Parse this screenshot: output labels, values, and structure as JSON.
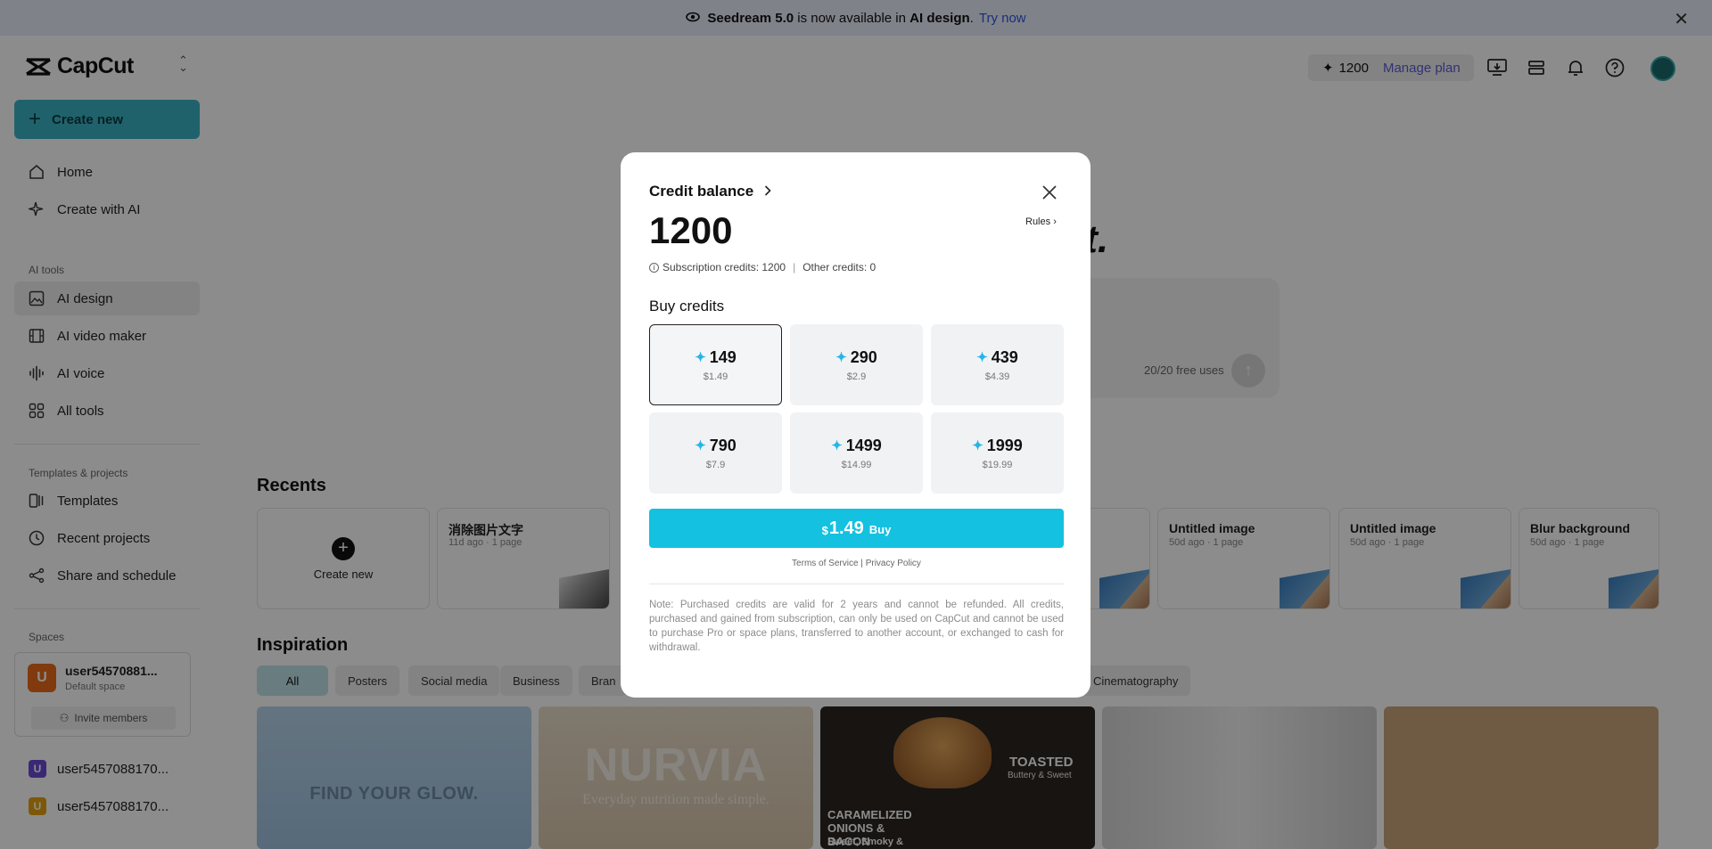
{
  "banner": {
    "icon": "seedream-icon",
    "product": "Seedream 5.0",
    "text_mid": " is now available in ",
    "feature": "AI design",
    "text_end": ".",
    "link": "Try now"
  },
  "sidebar": {
    "logo": "CapCut",
    "create_new": "Create new",
    "nav_main": [
      {
        "label": "Home",
        "icon": "home-icon"
      },
      {
        "label": "Create with AI",
        "icon": "sparkle-icon"
      }
    ],
    "ai_tools_label": "AI tools",
    "ai_tools": [
      {
        "label": "AI design",
        "icon": "image-edit-icon",
        "active": true
      },
      {
        "label": "AI video maker",
        "icon": "film-icon"
      },
      {
        "label": "AI voice",
        "icon": "waveform-icon"
      },
      {
        "label": "All tools",
        "icon": "grid-icon"
      }
    ],
    "templates_label": "Templates & projects",
    "templates": [
      {
        "label": "Templates",
        "icon": "template-icon"
      },
      {
        "label": "Recent projects",
        "icon": "clock-icon"
      },
      {
        "label": "Share and schedule",
        "icon": "share-icon"
      }
    ],
    "spaces_label": "Spaces",
    "space": {
      "initial": "U",
      "name": "user54570881...",
      "sub": "Default space",
      "invite": "Invite members"
    },
    "other_spaces": [
      {
        "initial": "U",
        "name": "user5457088170...",
        "color": "#6c4ad6"
      },
      {
        "initial": "U",
        "name": "user5457088170...",
        "color": "#e2a010"
      }
    ]
  },
  "header": {
    "credits": "1200",
    "manage_plan": "Manage plan"
  },
  "main": {
    "hero_fragment": "it.",
    "free_uses": "20/20 free uses",
    "recents_title": "Recents",
    "recents": [
      {
        "title": "Create new",
        "meta": ""
      },
      {
        "title": "消除图片文字",
        "meta": "11d ago · 1 page"
      },
      {
        "title": "Untitled image",
        "meta": "50d ago · 1 page"
      },
      {
        "title": "Untitled image",
        "meta": "50d ago · 1 page"
      },
      {
        "title": "Blur background",
        "meta": "50d ago · 1 page"
      }
    ],
    "inspiration_title": "Inspiration",
    "chips": [
      "All",
      "Posters",
      "Social media",
      "Business",
      "Bran",
      "Cinematography"
    ],
    "cards": [
      {
        "text": "FIND YOUR GLOW."
      },
      {
        "text": "NURVIA",
        "sub": "Everyday nutrition made simple."
      },
      {
        "text": "TOASTED",
        "sub": "Buttery & Sweet",
        "extra": "CARAMELIZED ONIONS & BACON",
        "extra2": "Sweet, Smoky &"
      },
      {
        "text": ""
      },
      {
        "text": ""
      }
    ]
  },
  "modal": {
    "title": "Credit balance",
    "balance": "1200",
    "rules": "Rules",
    "subscription_credits": "Subscription credits: 1200",
    "other_credits": "Other credits: 0",
    "buy_title": "Buy credits",
    "packages": [
      {
        "amount": "149",
        "price": "$1.49",
        "selected": true
      },
      {
        "amount": "290",
        "price": "$2.9"
      },
      {
        "amount": "439",
        "price": "$4.39"
      },
      {
        "amount": "790",
        "price": "$7.9"
      },
      {
        "amount": "1499",
        "price": "$14.99"
      },
      {
        "amount": "1999",
        "price": "$19.99"
      }
    ],
    "buy_currency": "$",
    "buy_value": "1.49",
    "buy_label": "Buy",
    "terms": "Terms of Service",
    "privacy": "Privacy Policy",
    "note": "Note: Purchased credits are valid for 2 years and cannot be refunded. All credits, purchased and gained from subscription, can only be used on CapCut and cannot be used to purchase Pro or space plans, transferred to another account, or exchanged to cash for withdrawal.",
    "accent_color": "#14c1e0"
  }
}
